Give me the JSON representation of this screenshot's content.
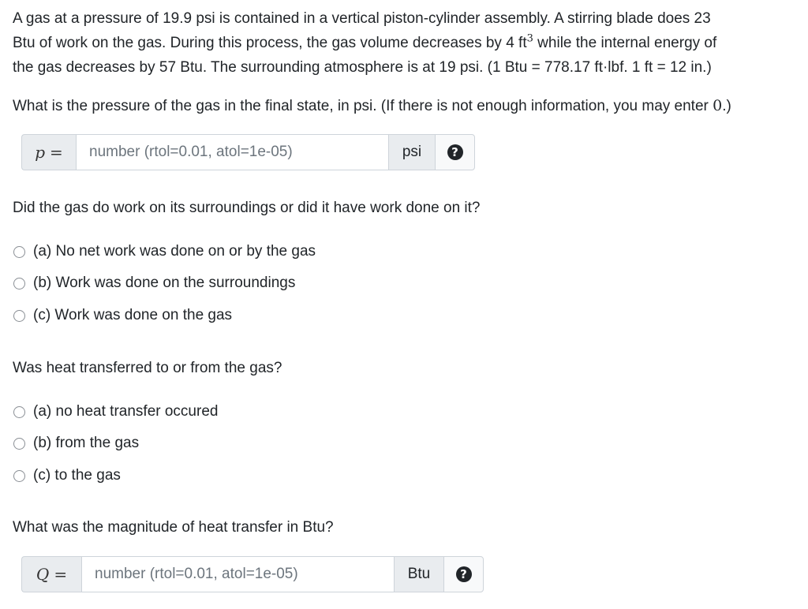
{
  "problem": {
    "line1": "A gas at a pressure of 19.9 psi is contained in a vertical piston-cylinder assembly. A stirring blade does 23",
    "line2_pre": "Btu of work on the gas. During this process, the gas volume decreases by 4 ft",
    "line2_sup": "3",
    "line2_post": " while the internal energy of",
    "line3": "the gas decreases by 57 Btu. The surrounding atmosphere is at 19 psi. (1 Btu = 778.17 ft·lbf. 1 ft = 12 in.)"
  },
  "q1": {
    "text": "What is the pressure of the gas in the final state, in psi. (If there is not enough information, you may enter ",
    "zero": "0",
    "text_end": ".)",
    "prefix_var": "p",
    "prefix_eq": "=",
    "placeholder": "number (rtol=0.01, atol=1e-05)",
    "unit": "psi",
    "help": "?"
  },
  "q2": {
    "text": "Did the gas do work on its surroundings or did it have work done on it?",
    "options": [
      "(a) No net work was done on or by the gas",
      "(b) Work was done on the surroundings",
      "(c) Work was done on the gas"
    ]
  },
  "q3": {
    "text": "Was heat transferred to or from the gas?",
    "options": [
      "(a) no heat transfer occured",
      "(b) from the gas",
      "(c) to the gas"
    ]
  },
  "q4": {
    "text": "What was the magnitude of heat transfer in Btu?",
    "prefix_var": "Q",
    "prefix_eq": "=",
    "placeholder": "number (rtol=0.01, atol=1e-05)",
    "unit": "Btu",
    "help": "?"
  }
}
